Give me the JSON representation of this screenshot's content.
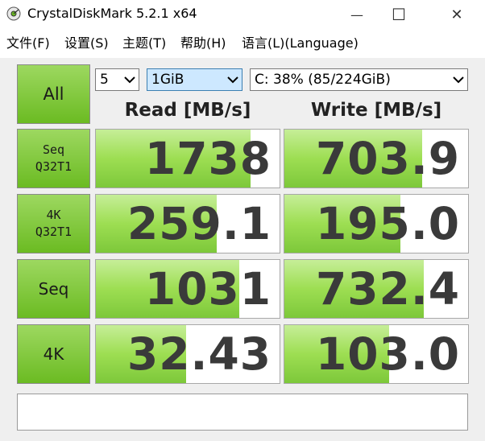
{
  "window": {
    "title": "CrystalDiskMark 5.2.1 x64",
    "minimize_glyph": "—",
    "maximize_glyph": "☐",
    "close_glyph": "✕"
  },
  "menu": [
    "文件(F)",
    "设置(S)",
    "主题(T)",
    "帮助(H)",
    "语言(L)(Language)"
  ],
  "controls": {
    "all_label": "All",
    "count": "5",
    "size": "1GiB",
    "drive": "C: 38% (85/224GiB)"
  },
  "headers": {
    "read": "Read [MB/s]",
    "write": "Write [MB/s]"
  },
  "rows": [
    {
      "label": "Seq\nQ32T1",
      "read": "1738",
      "write": "703.9",
      "read_fill": 0.84,
      "write_fill": 0.75
    },
    {
      "label": "4K\nQ32T1",
      "read": "259.1",
      "write": "195.0",
      "read_fill": 0.66,
      "write_fill": 0.63
    },
    {
      "label": "Seq",
      "read": "1031",
      "write": "732.4",
      "read_fill": 0.78,
      "write_fill": 0.76
    },
    {
      "label": "4K",
      "read": "32.43",
      "write": "103.0",
      "read_fill": 0.49,
      "write_fill": 0.57
    }
  ],
  "colors": {
    "button_green": "#7cc533",
    "bar_green": "#9dde52",
    "value_text": "#3a3a3a"
  }
}
